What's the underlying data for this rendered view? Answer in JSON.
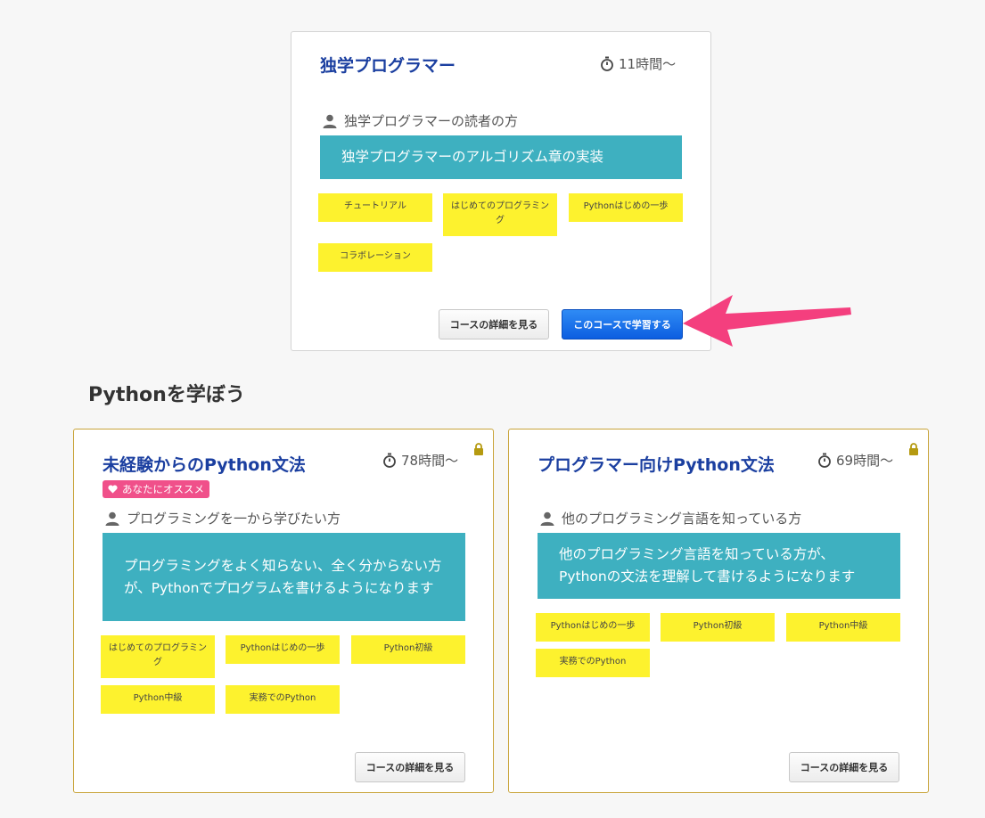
{
  "featured_course": {
    "title": "独学プログラマー",
    "hours": "11時間〜",
    "target": "独学プログラマーの読者の方",
    "description": "独学プログラマーのアルゴリズム章の実装",
    "tags": [
      "チュートリアル",
      "はじめてのプログラミング",
      "Pythonはじめの一歩",
      "コラボレーション"
    ],
    "detail_button": "コースの詳細を見る",
    "start_button": "このコースで学習する",
    "icons": {
      "timer": "stopwatch-icon",
      "person": "person-icon"
    }
  },
  "section": {
    "title": "Pythonを学ぼう"
  },
  "courses": [
    {
      "title": "未経験からのPython文法",
      "hours": "78時間〜",
      "badge": "あなたにオススメ",
      "target": "プログラミングを一から学びたい方",
      "description": "プログラミングをよく知らない、全く分からない方が、Pythonでプログラムを書けるようになります",
      "tags": [
        "はじめてのプログラミング",
        "Pythonはじめの一歩",
        "Python初級",
        "Python中級",
        "実務でのPython"
      ],
      "detail_button": "コースの詳細を見る",
      "locked": true
    },
    {
      "title": "プログラマー向けPython文法",
      "hours": "69時間〜",
      "target": "他のプログラミング言語を知っている方",
      "description": "他のプログラミング言語を知っている方が、Pythonの文法を理解して書けるようになります",
      "tags": [
        "Pythonはじめの一歩",
        "Python初級",
        "Python中級",
        "実務でのPython"
      ],
      "detail_button": "コースの詳細を見る",
      "locked": true
    }
  ],
  "colors": {
    "title": "#1b3fa0",
    "description_bg": "#3eb0c0",
    "tag_bg": "#fdf22e",
    "badge_bg": "#f0508a",
    "primary_button": "#1a6fe8",
    "card_border_gold": "#c9a43a",
    "annotation_arrow": "#f43f7e"
  }
}
